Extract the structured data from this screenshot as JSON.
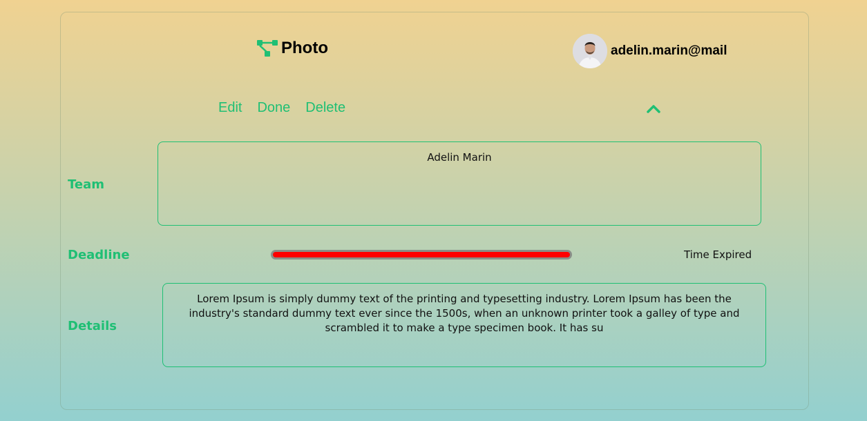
{
  "header": {
    "brand_icon": "hierarchy-icon",
    "brand_name": "Photo",
    "user_email": "adelin.marin@mail"
  },
  "actions": {
    "edit_label": "Edit",
    "done_label": "Done",
    "delete_label": "Delete",
    "collapse_icon": "chevron-up-icon"
  },
  "team": {
    "label": "Team",
    "members": "Adelin Marin"
  },
  "deadline": {
    "label": "Deadline",
    "progress_percent": 100,
    "status": "Time Expired"
  },
  "details": {
    "label": "Details",
    "text": "Lorem Ipsum is simply dummy text of the printing and typesetting industry. Lorem Ipsum has been the industry's standard dummy text ever since the 1500s, when an unknown printer took a galley of type and scrambled it to make a type specimen book. It has su"
  },
  "colors": {
    "accent": "#1fbf74",
    "progress_fill": "#ff0000",
    "progress_track": "#8a8f88"
  }
}
